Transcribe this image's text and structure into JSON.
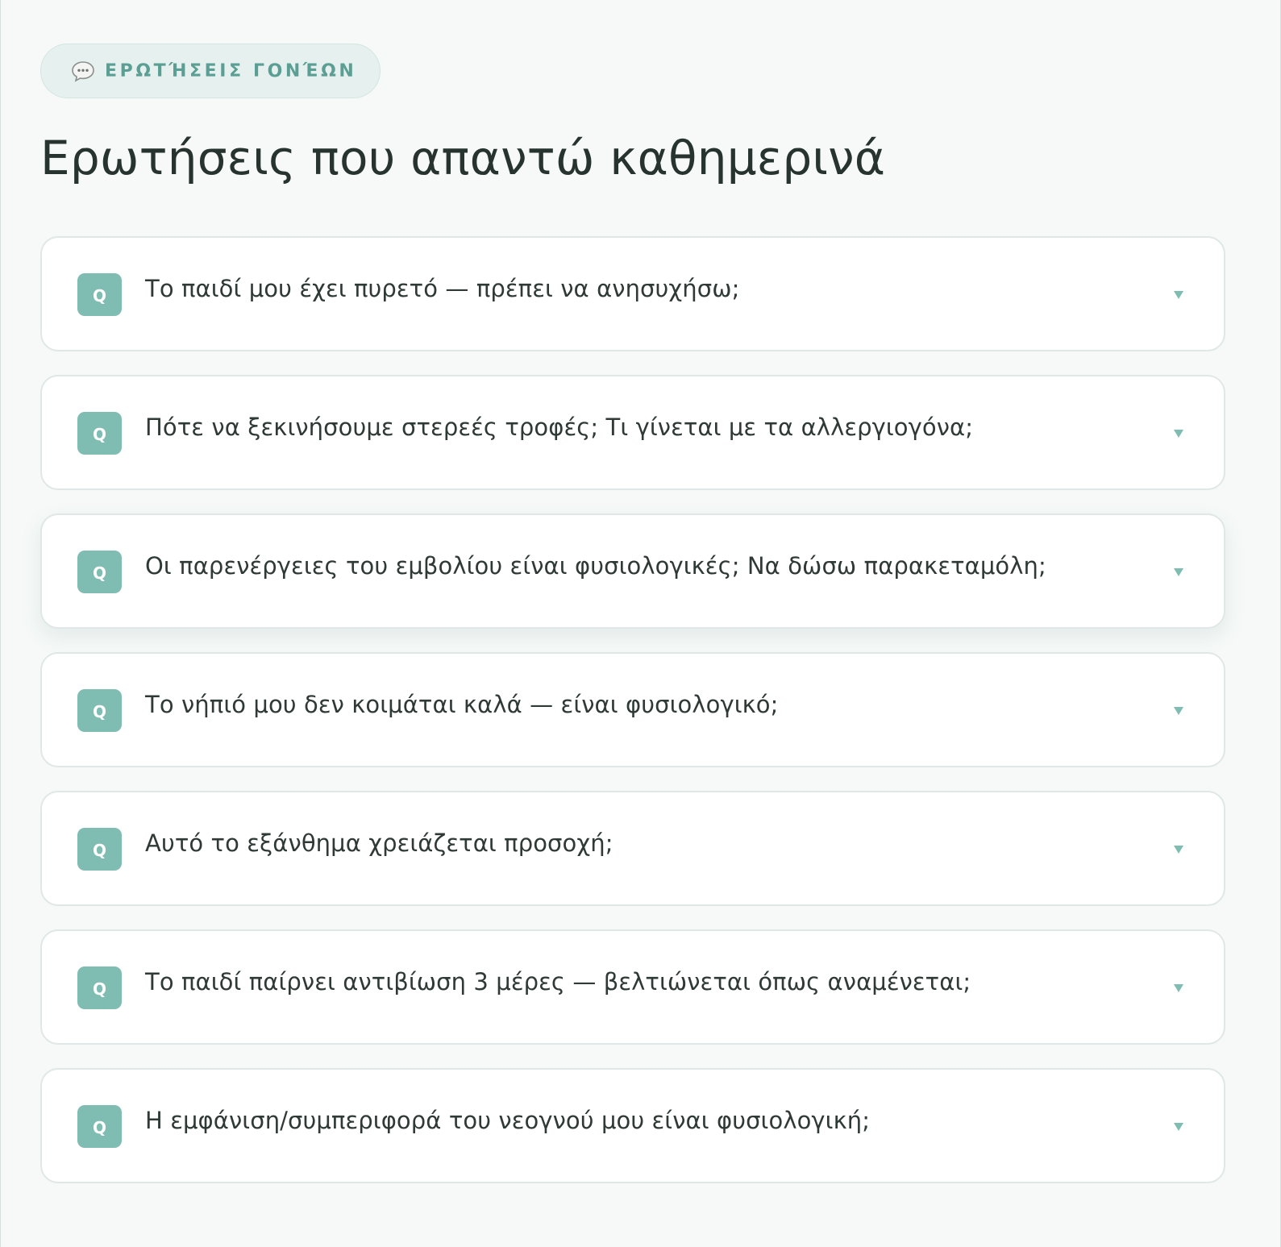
{
  "section_tag": {
    "label": "ΕΡΩΤΉΣΕΙΣ ΓΟΝΈΩΝ",
    "icon": "speech-bubble-icon"
  },
  "title": "Ερωτήσεις που απαντώ καθημερινά",
  "faq": {
    "badge_label": "Q",
    "expand_icon": "chevron-down-icon",
    "items": [
      {
        "question": "Το παιδί μου έχει πυρετό — πρέπει να ανησυχήσω;"
      },
      {
        "question": "Πότε να ξεκινήσουμε στερεές τροφές; Τι γίνεται με τα αλλεργιογόνα;"
      },
      {
        "question": "Οι παρενέργειες του εμβολίου είναι φυσιολογικές; Να δώσω παρακεταμόλη;"
      },
      {
        "question": "Το νήπιό μου δεν κοιμάται καλά — είναι φυσιολογικό;"
      },
      {
        "question": "Αυτό το εξάνθημα χρειάζεται προσοχή;"
      },
      {
        "question": "Το παιδί παίρνει αντιβίωση 3 μέρες — βελτιώνεται όπως αναμένεται;"
      },
      {
        "question": "Η εμφάνιση/συμπεριφορά του νεογνού μου είναι φυσιολογική;"
      }
    ]
  },
  "colors": {
    "accent": "#7fbdb2",
    "accent_text": "#5b9f94",
    "background": "#f6f9f8",
    "card": "#ffffff",
    "heading": "#27332f"
  }
}
